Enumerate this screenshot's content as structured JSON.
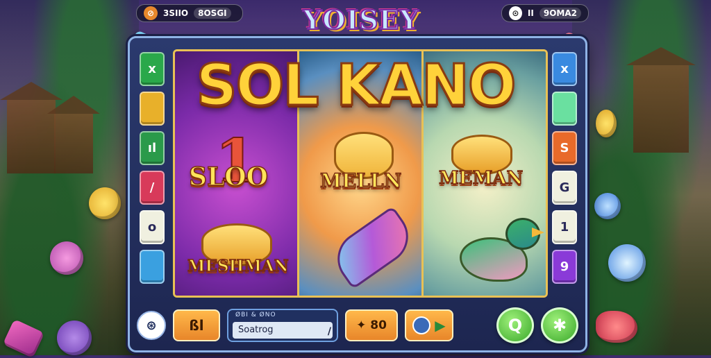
{
  "header": {
    "left_badge": {
      "icon": "coin-ring-icon",
      "icon_glyph": "⊘",
      "label": "3SIIO",
      "pill": "8OSGI"
    },
    "brand_title": "YOISEY",
    "right_badge": {
      "icon": "alert-circle-icon",
      "icon_glyph": "⊙",
      "label": "II",
      "pill": "9OMA2"
    }
  },
  "main_logo": "SOL KANO",
  "reels": {
    "reel1": {
      "glyph": "1",
      "word_top": "SLOO",
      "word_bottom": "MESHMAN"
    },
    "reel2": {
      "word_top": "MELLN"
    },
    "reel3": {
      "word_top": "MEMAN"
    }
  },
  "left_side_buttons": [
    {
      "label": "x",
      "color": "#2aa84a",
      "icon": "close-icon"
    },
    {
      "label": "",
      "color": "#e8b02a",
      "icon": "coin-icon"
    },
    {
      "label": "ıl",
      "color": "#2a9a4a",
      "icon": "bars-icon"
    },
    {
      "label": "/",
      "color": "#d83a5a",
      "icon": "slash-icon"
    },
    {
      "label": "o",
      "color": "#f0f0e0",
      "icon": "zero-icon"
    },
    {
      "label": "",
      "color": "#3aa0e0",
      "icon": "gem-icon"
    }
  ],
  "right_side_buttons": [
    {
      "label": "x",
      "color": "#3a8ae0",
      "icon": "close-icon"
    },
    {
      "label": "",
      "color": "#6ae0a0",
      "icon": "gem-icon"
    },
    {
      "label": "S",
      "color": "#e86a2a",
      "icon": "s-icon"
    },
    {
      "label": "G",
      "color": "#f0f0e0",
      "icon": "g-icon"
    },
    {
      "label": "1",
      "color": "#f0f0e0",
      "icon": "one-icon"
    },
    {
      "label": "9",
      "color": "#8a3ad8",
      "icon": "nine-icon"
    }
  ],
  "bottom": {
    "radio_glyph": "⊛",
    "bet_label": "ßl",
    "search_caption": "ØBI & ØNO",
    "search_value": "Soatrog",
    "search_slash": "/",
    "bet_display": "✦ 80",
    "play_glyph": "▶",
    "spin_button": "Q",
    "auto_button": "✱"
  },
  "colors": {
    "frame": "#2b3a6e",
    "frame_border": "#8fb3e6",
    "reel_border": "#e9c155",
    "logo_gold": "#ffd23a",
    "green_button": "#4cb83a"
  }
}
